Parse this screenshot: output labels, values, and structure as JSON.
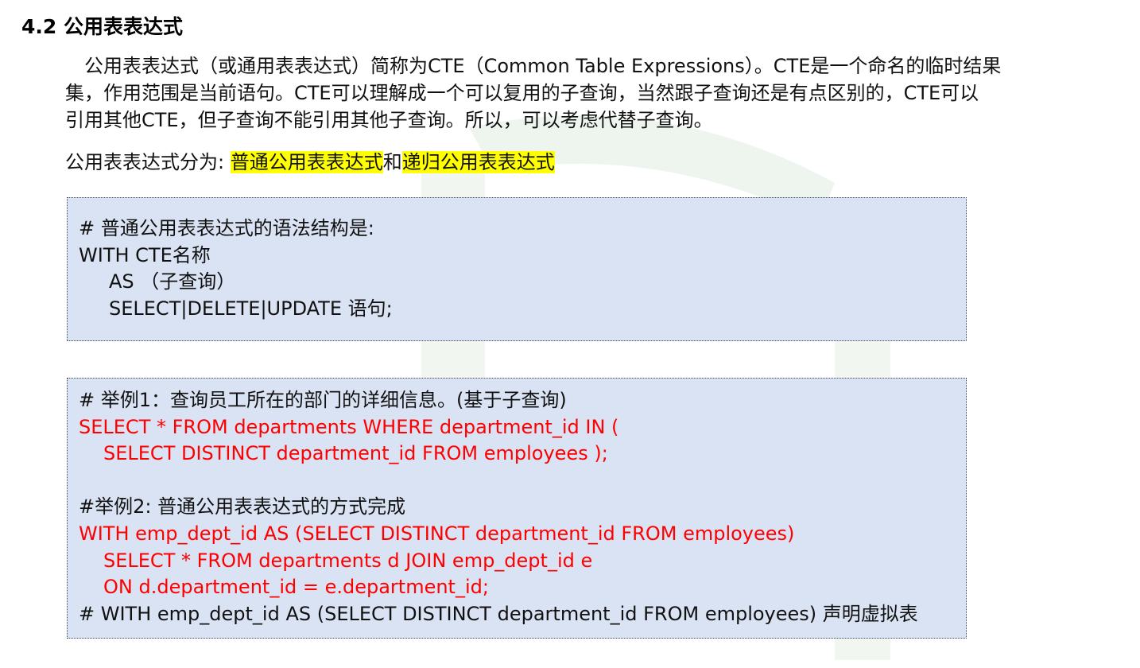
{
  "section": {
    "heading": "4.2 公用表表达式"
  },
  "intro": {
    "lines": [
      "公用表表达式（或通用表表达式）简称为CTE（Common Table Expressions）。CTE是一个命名的临时结果",
      "集，作用范围是当前语句。CTE可以理解成一个可以复用的子查询，当然跟子查询还是有点区别的，CTE可以",
      "引用其他CTE，但子查询不能引用其他子查询。所以，可以考虑代替子查询。"
    ]
  },
  "types": {
    "prefix": "公用表表达式分为: ",
    "type1": "普通公用表表达式",
    "connector": "和",
    "type2": "递归公用表表达式"
  },
  "syntax_box": {
    "lines": [
      "# 普通公用表表达式的语法结构是:",
      "WITH CTE名称",
      "AS （子查询）",
      "SELECT|DELETE|UPDATE 语句;"
    ]
  },
  "example_box": {
    "lines": [
      "# 举例1：查询员工所在的部门的详细信息。(基于子查询)",
      "SELECT * FROM departments WHERE department_id IN (",
      "SELECT DISTINCT department_id FROM employees );",
      "",
      "#举例2: 普通公用表表达式的方式完成",
      "WITH emp_dept_id AS (SELECT DISTINCT department_id FROM employees)",
      "SELECT * FROM departments d JOIN emp_dept_id e",
      "ON d.department_id = e.department_id;",
      "# WITH emp_dept_id AS (SELECT DISTINCT department_id FROM employees) 声明虚拟表"
    ]
  },
  "colors": {
    "code_box_bg": "#dae3f3",
    "code_red": "#ff0000",
    "highlight": "#ffff00"
  }
}
